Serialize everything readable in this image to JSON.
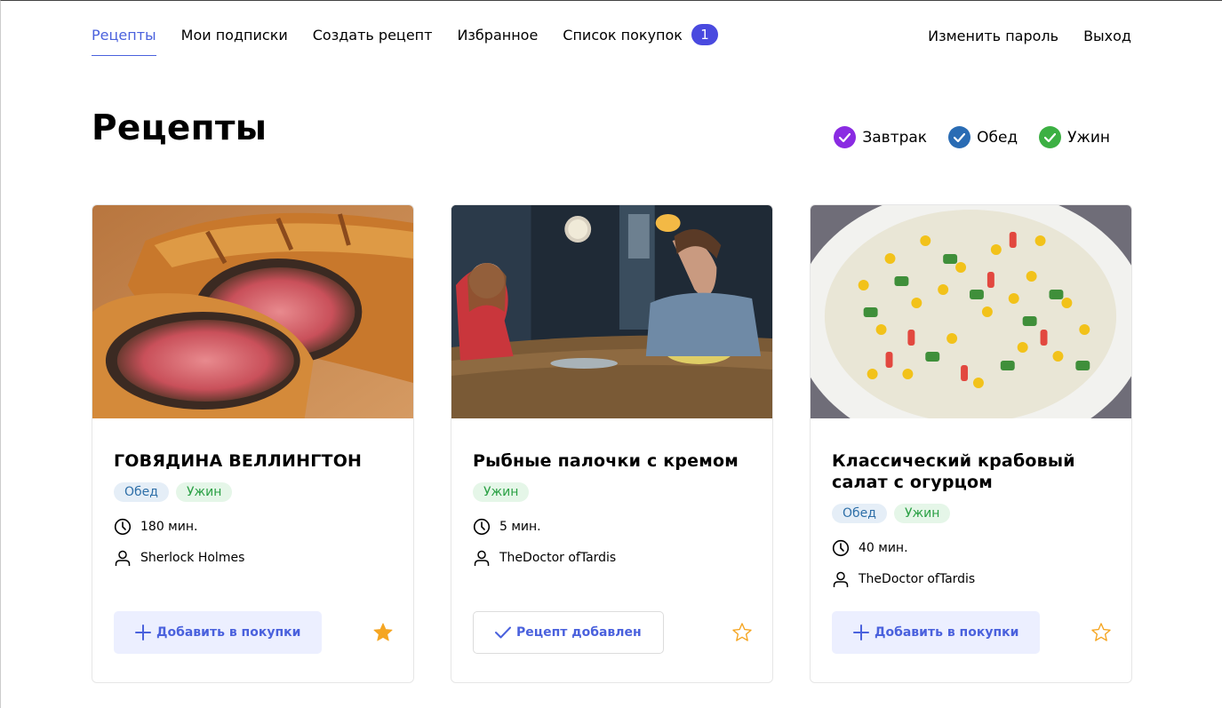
{
  "nav": {
    "items": [
      {
        "label": "Рецепты",
        "active": true
      },
      {
        "label": "Мои подписки",
        "active": false
      },
      {
        "label": "Создать рецепт",
        "active": false
      },
      {
        "label": "Избранное",
        "active": false
      },
      {
        "label": "Список покупок",
        "active": false
      }
    ],
    "shopping_count": "1",
    "change_password": "Изменить пароль",
    "logout": "Выход"
  },
  "page": {
    "title": "Рецепты"
  },
  "filters": [
    {
      "label": "Завтрак",
      "color": "#8a2be2",
      "checked": true
    },
    {
      "label": "Обед",
      "color": "#2a6cb4",
      "checked": true
    },
    {
      "label": "Ужин",
      "color": "#3cb043",
      "checked": true
    }
  ],
  "cards": [
    {
      "title": "ГОВЯДИНА ВЕЛЛИНГТОН",
      "tags": [
        "Обед",
        "Ужин"
      ],
      "time": "180 мин.",
      "author": "Sherlock Holmes",
      "button_label": "Добавить в покупки",
      "button_state": "add",
      "favorite": true
    },
    {
      "title": "Рыбные палочки с кремом",
      "tags": [
        "Ужин"
      ],
      "time": "5 мин.",
      "author": "TheDoctor ofTardis",
      "button_label": "Рецепт добавлен",
      "button_state": "added",
      "favorite": false
    },
    {
      "title": "Классический крабовый салат с огурцом",
      "tags": [
        "Обед",
        "Ужин"
      ],
      "time": "40 мин.",
      "author": "TheDoctor ofTardis",
      "button_label": "Добавить в покупки",
      "button_state": "add",
      "favorite": false
    }
  ],
  "colors": {
    "accent": "#4a61dd",
    "star": "#f5a623"
  }
}
